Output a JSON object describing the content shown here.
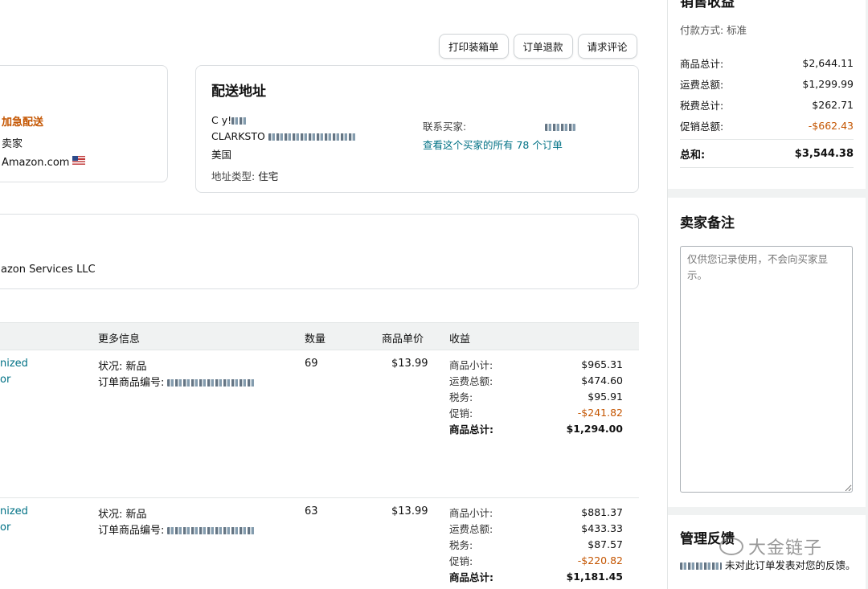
{
  "actions": {
    "print": "打印装箱单",
    "refund": "订单退款",
    "review": "请求评论"
  },
  "order_card": {
    "shipping_service": "加急配送",
    "fulfillment": "卖家",
    "sales_channel": "Amazon.com"
  },
  "shipping": {
    "title": "配送地址",
    "name": "C  y!",
    "city": "CLARKSTO",
    "country": "美国",
    "address_type_label": "地址类型:",
    "address_type": "住宅",
    "contact_label": "联系买家:",
    "all_orders_link": "查看这个买家的所有 78 个订单"
  },
  "seller": {
    "name": "azon Services LLC"
  },
  "table": {
    "headers": [
      "更多信息",
      "数量",
      "商品单价",
      "收益"
    ],
    "rows": [
      {
        "product_line1": "nized",
        "product_line2": "or",
        "status": "状况: 新品",
        "item_id_label": "订单商品编号:",
        "qty": "69",
        "unit_price": "$13.99",
        "earnings": [
          {
            "label": "商品小计:",
            "value": "$965.31"
          },
          {
            "label": "运费总额:",
            "value": "$474.60"
          },
          {
            "label": "税务:",
            "value": "$95.91"
          },
          {
            "label": "促销:",
            "value": "-$241.82"
          },
          {
            "label": "商品总计:",
            "value": "$1,294.00"
          }
        ]
      },
      {
        "product_line1": "nized",
        "product_line2": "or",
        "status": "状况: 新品",
        "item_id_label": "订单商品编号:",
        "qty": "63",
        "unit_price": "$13.99",
        "earnings": [
          {
            "label": "商品小计:",
            "value": "$881.37"
          },
          {
            "label": "运费总额:",
            "value": "$433.33"
          },
          {
            "label": "税务:",
            "value": "$87.57"
          },
          {
            "label": "促销:",
            "value": "-$220.82"
          },
          {
            "label": "商品总计:",
            "value": "$1,181.45"
          }
        ]
      }
    ]
  },
  "sidebar": {
    "earnings_title": "销售收益",
    "payment_method": "付款方式: 标准",
    "summary": [
      {
        "label": "商品总计:",
        "value": "$2,644.11"
      },
      {
        "label": "运费总额:",
        "value": "$1,299.99"
      },
      {
        "label": "税费总计:",
        "value": "$262.71"
      },
      {
        "label": "促销总额:",
        "value": "-$662.43"
      }
    ],
    "total_label": "总和:",
    "total_value": "$3,544.38",
    "notes_title": "卖家备注",
    "notes_placeholder": "仅供您记录使用，不会向买家显示。",
    "feedback_title": "管理反馈",
    "feedback_text": "未对此订单发表对您的反馈。"
  },
  "watermark": "大金链子",
  "colors": {
    "link": "#007185",
    "orange": "#c45500",
    "header_bg": "#f0f2f2"
  }
}
